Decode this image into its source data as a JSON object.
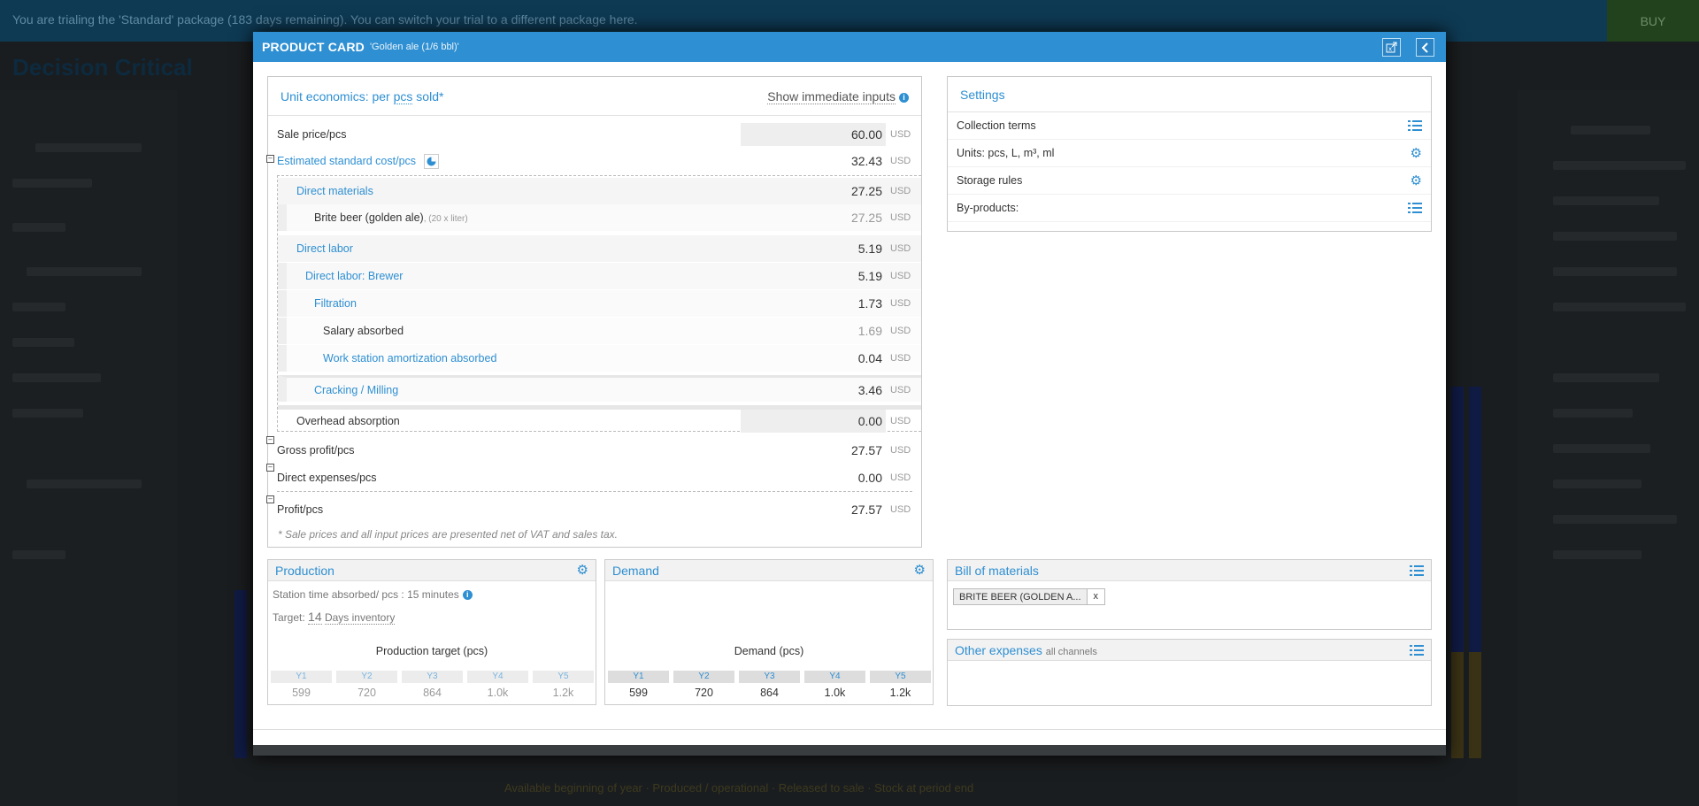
{
  "banner": {
    "text": "You are trialing the 'Standard' package (183 days remaining). You can switch your trial to a different package here.",
    "buy_label": "BUY"
  },
  "background": {
    "logo": "Decision Critical",
    "legend": "Available beginning of year · Produced / operational · Released to sale · Stock at period end"
  },
  "modal": {
    "title": "PRODUCT CARD",
    "subtitle": "'Golden ale (1/6 bbl)'",
    "unit_economics": {
      "title_prefix": "Unit economics: per",
      "unit": "pcs",
      "title_suffix": "sold*",
      "show_inputs_label": "Show immediate inputs",
      "currency": "USD",
      "sale_price": {
        "label": "Sale price/pcs",
        "value": "60.00"
      },
      "est_cost": {
        "label": "Estimated standard cost/pcs",
        "value": "32.43"
      },
      "direct_materials": {
        "label": "Direct materials",
        "value": "27.25"
      },
      "brite_beer": {
        "label": "Brite beer (golden ale)",
        "qty": ", (20 x liter)",
        "value": "27.25"
      },
      "direct_labor": {
        "label": "Direct labor",
        "value": "5.19"
      },
      "direct_labor_brewer": {
        "label": "Direct labor: Brewer",
        "value": "5.19"
      },
      "filtration": {
        "label": "Filtration",
        "value": "1.73"
      },
      "salary_absorbed": {
        "label": "Salary absorbed",
        "value": "1.69"
      },
      "ws_amort": {
        "label": "Work station amortization absorbed",
        "value": "0.04"
      },
      "cracking": {
        "label": "Cracking / Milling",
        "value": "3.46"
      },
      "overhead": {
        "label": "Overhead absorption",
        "value": "0.00"
      },
      "gross_profit": {
        "label": "Gross profit/pcs",
        "value": "27.57"
      },
      "direct_expenses": {
        "label": "Direct expenses/pcs",
        "value": "0.00"
      },
      "profit": {
        "label": "Profit/pcs",
        "value": "27.57"
      },
      "note": "* Sale prices and all input prices are presented net of VAT and sales tax."
    },
    "settings": {
      "title": "Settings",
      "items": [
        "Collection terms",
        "Units: pcs, L, m³, ml",
        "Storage rules",
        "By-products:"
      ]
    },
    "production": {
      "title": "Production",
      "station_time": "Station time absorbed/ pcs : 15 minutes",
      "target_prefix": "Target:",
      "target_value": "14",
      "target_suffix": "Days inventory",
      "table_title": "Production target (pcs)",
      "years": [
        "Y1",
        "Y2",
        "Y3",
        "Y4",
        "Y5"
      ],
      "values": [
        "599",
        "720",
        "864",
        "1.0k",
        "1.2k"
      ]
    },
    "demand": {
      "title": "Demand",
      "table_title": "Demand (pcs)",
      "years": [
        "Y1",
        "Y2",
        "Y3",
        "Y4",
        "Y5"
      ],
      "values": [
        "599",
        "720",
        "864",
        "1.0k",
        "1.2k"
      ]
    },
    "bom": {
      "title": "Bill of materials",
      "tag": "BRITE BEER (GOLDEN A...",
      "remove": "x"
    },
    "other_expenses": {
      "title": "Other expenses",
      "subtitle": "all channels"
    }
  },
  "colors": {
    "accent": "#2e8fd2",
    "banner": "#0e3a54"
  }
}
